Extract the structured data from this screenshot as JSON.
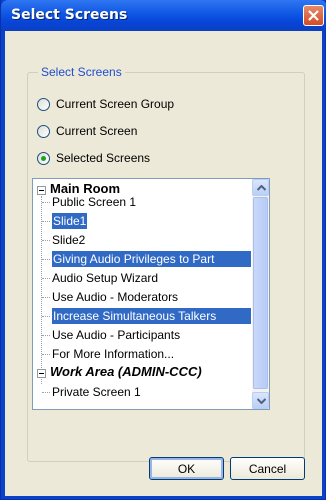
{
  "window": {
    "title": "Select Screens"
  },
  "group": {
    "legend": "Select Screens"
  },
  "options": [
    {
      "label": "Current Screen Group",
      "selected": false
    },
    {
      "label": "Current Screen",
      "selected": false
    },
    {
      "label": "Selected Screens",
      "selected": true
    }
  ],
  "tree": {
    "groups": [
      {
        "label": "Main Room",
        "items": [
          {
            "label": "Public Screen 1",
            "selected": false
          },
          {
            "label": "Slide1",
            "selected": true
          },
          {
            "label": "Slide2",
            "selected": false
          },
          {
            "label": "Giving Audio Privileges to Part",
            "selected": true
          },
          {
            "label": "Audio Setup Wizard",
            "selected": false
          },
          {
            "label": "Use Audio - Moderators",
            "selected": false
          },
          {
            "label": "Increase Simultaneous Talkers",
            "selected": true
          },
          {
            "label": "Use Audio - Participants",
            "selected": false
          },
          {
            "label": "For More Information...",
            "selected": false
          }
        ]
      },
      {
        "label": "Work Area (ADMIN-CCC)",
        "items": [
          {
            "label": "Private Screen 1",
            "selected": false
          }
        ]
      }
    ]
  },
  "buttons": {
    "ok": "OK",
    "cancel": "Cancel"
  },
  "colors": {
    "selection": "#316ac5",
    "title_bar": "#0a42c9",
    "dialog_bg": "#ece9d8"
  }
}
